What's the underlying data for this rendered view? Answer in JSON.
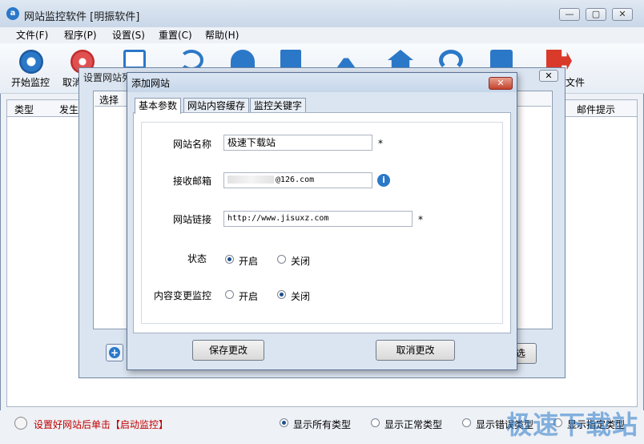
{
  "window": {
    "title": "网站监控软件 [明振软件]",
    "min": "—",
    "max": "▢",
    "close": "✕",
    "icon": "a"
  },
  "menu": [
    "文件(F)",
    "程序(P)",
    "设置(S)",
    "重置(C)",
    "帮助(H)"
  ],
  "toolbar": {
    "start_label": "开始监控",
    "cancel_label": "取消",
    "file_label": "文件",
    "icons": [
      "webcam-icon",
      "stop-icon",
      "screen-icon",
      "refresh-icon",
      "gauge-icon",
      "edit-icon",
      "broom-icon",
      "home-icon",
      "headset-icon",
      "contact-icon",
      "exit-icon"
    ]
  },
  "list": {
    "col_type": "类型",
    "col_time": "发生",
    "col_mail": "邮件提示"
  },
  "status": {
    "hint": "设置好网站后单击【启动监控】",
    "opt_all": "显示所有类型",
    "opt_normal": "显示正常类型",
    "opt_error": "显示错误类型",
    "opt_last": "显示指定类型"
  },
  "dialog2": {
    "title": "设置网站列表",
    "tab": "选择",
    "close": "✕",
    "btn_right": "选"
  },
  "dialog1": {
    "title": "添加网站",
    "close": "✕",
    "tabs": [
      "基本参数",
      "网站内容缓存",
      "监控关键字"
    ],
    "fields": {
      "name_label": "网站名称",
      "name_value": "极速下载站",
      "email_label": "接收邮箱",
      "email_value": "@126.com",
      "url_label": "网站链接",
      "url_value": "http://www.jisuxz.com",
      "state_label": "状态",
      "state_on": "开启",
      "state_off": "关闭",
      "monitor_label": "内容变更监控",
      "monitor_on": "开启",
      "monitor_off": "关闭",
      "required": "*"
    },
    "buttons": {
      "save": "保存更改",
      "cancel": "取消更改"
    }
  },
  "watermark": "极速下载站",
  "colors": {
    "accent": "#2b78c8",
    "hint_red": "#c00000",
    "close_red": "#c4422c"
  }
}
